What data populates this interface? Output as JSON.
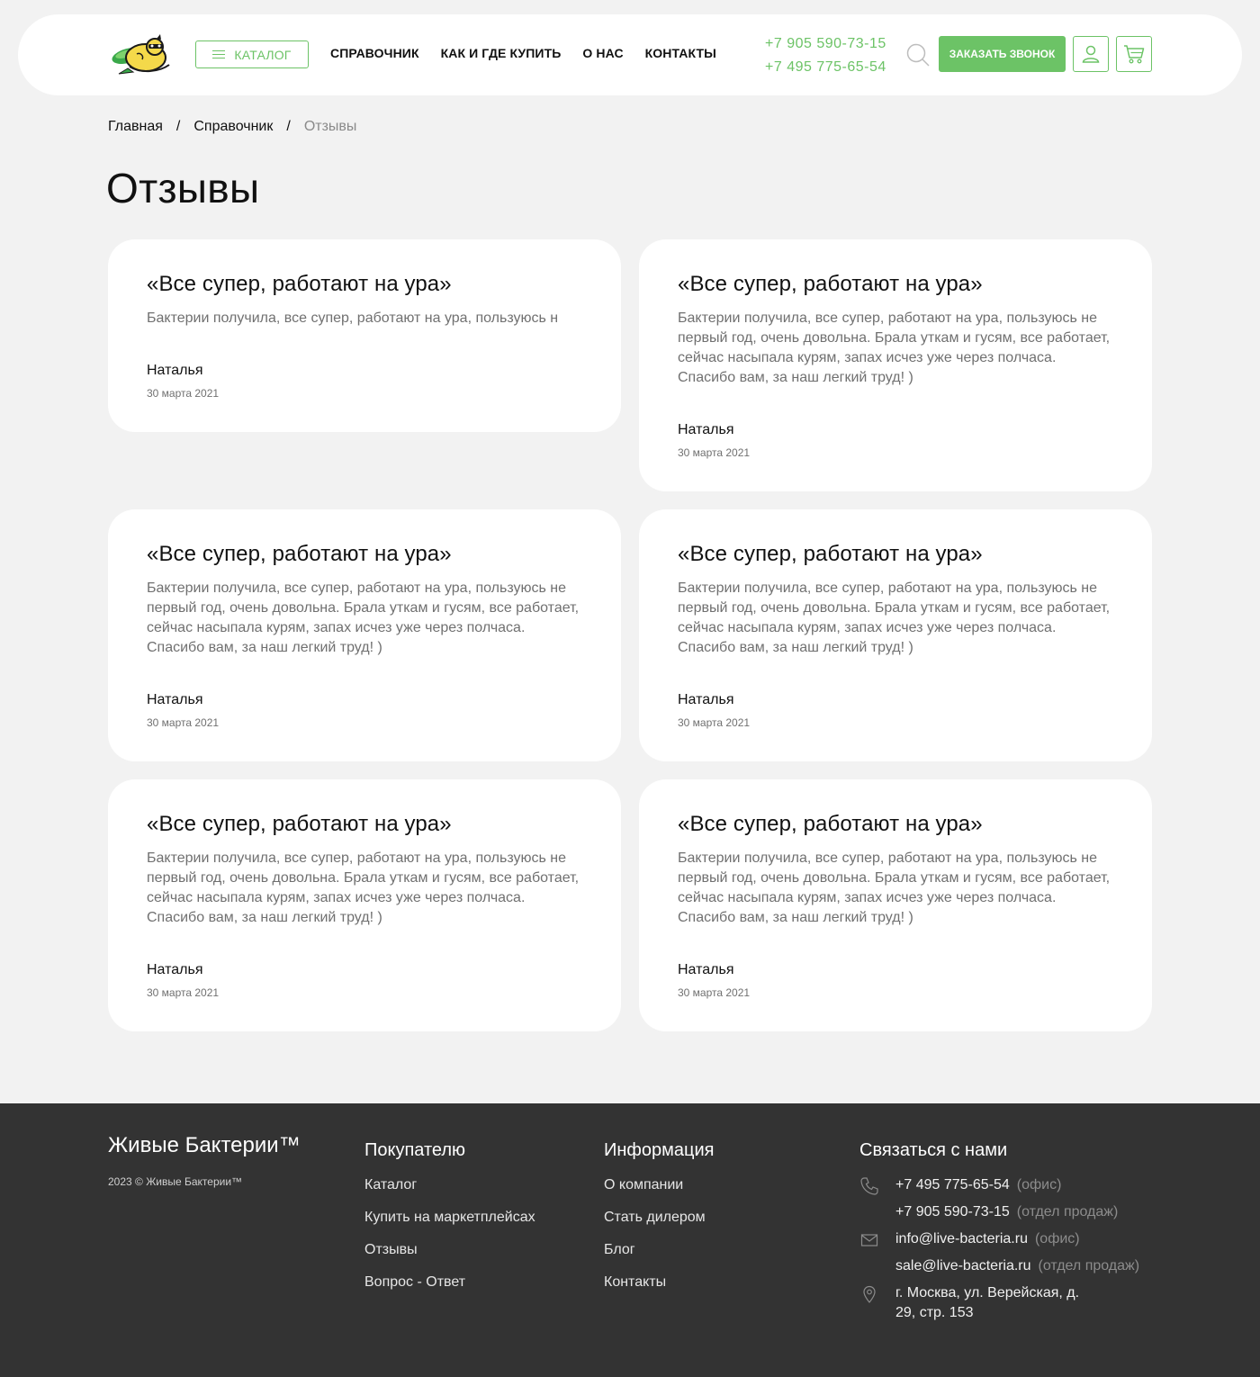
{
  "header": {
    "catalog_label": "КАТАЛОГ",
    "nav": [
      "СПРАВОЧНИК",
      "КАК И ГДЕ КУПИТЬ",
      "О НАС",
      "КОНТАКТЫ"
    ],
    "phones": [
      "+7 905 590-73-15",
      "+7 495 775-65-54"
    ],
    "call_label": "ЗАКАЗАТЬ ЗВОНОК",
    "accent_color": "#6cc366"
  },
  "breadcrumb": {
    "items": [
      "Главная",
      "Справочник"
    ],
    "separator": "/",
    "current": "Отзывы"
  },
  "page": {
    "title": "Отзывы"
  },
  "reviews": [
    {
      "title": "«Все супер, работают на ура»",
      "text": "Бактерии получила, все супер, работают на ура, пользуюсь н",
      "author": "Наталья",
      "date": "30 марта 2021"
    },
    {
      "title": "«Все супер, работают на ура»",
      "text": "Бактерии получила, все супер, работают на ура, пользуюсь не первый год, очень довольна. Брала уткам и гусям, все работает, сейчас насыпала курям, запах исчез уже через полчаса. Спасибо вам, за наш легкий труд! )",
      "author": "Наталья",
      "date": "30 марта 2021"
    },
    {
      "title": "«Все супер, работают на ура»",
      "text": "Бактерии получила, все супер, работают на ура, пользуюсь не первый год, очень довольна. Брала уткам и гусям, все работает, сейчас насыпала курям, запах исчез уже через полчаса. Спасибо вам, за наш легкий труд! )",
      "author": "Наталья",
      "date": "30 марта 2021"
    },
    {
      "title": "«Все супер, работают на ура»",
      "text": "Бактерии получила, все супер, работают на ура, пользуюсь не первый год, очень довольна. Брала уткам и гусям, все работает, сейчас насыпала курям, запах исчез уже через полчаса. Спасибо вам, за наш легкий труд! )",
      "author": "Наталья",
      "date": "30 марта 2021"
    },
    {
      "title": "«Все супер, работают на ура»",
      "text": "Бактерии получила, все супер, работают на ура, пользуюсь не первый год, очень довольна. Брала уткам и гусям, все работает, сейчас насыпала курям, запах исчез уже через полчаса. Спасибо вам, за наш легкий труд! )",
      "author": "Наталья",
      "date": "30 марта 2021"
    },
    {
      "title": "«Все супер, работают на ура»",
      "text": "Бактерии получила, все супер, работают на ура, пользуюсь не первый год, очень довольна. Брала уткам и гусям, все работает, сейчас насыпала курям, запах исчез уже через полчаса. Спасибо вам, за наш легкий труд! )",
      "author": "Наталья",
      "date": "30 марта 2021"
    }
  ],
  "footer": {
    "brand": "Живые Бактерии™",
    "copyright": "2023 © Живые Бактерии™",
    "buyer": {
      "heading": "Покупателю",
      "links": [
        "Каталог",
        "Купить на маркетплейсах",
        "Отзывы",
        "Вопрос - Ответ"
      ]
    },
    "info": {
      "heading": "Информация",
      "links": [
        "О компании",
        "Стать дилером",
        "Блог",
        "Контакты"
      ]
    },
    "contacts": {
      "heading": "Связаться с нами",
      "phones": [
        {
          "value": "+7 495 775-65-54",
          "note": "(офис)"
        },
        {
          "value": "+7 905 590-73-15",
          "note": "(отдел продаж)"
        }
      ],
      "emails": [
        {
          "value": "info@live-bacteria.ru",
          "note": "(офис)"
        },
        {
          "value": "sale@live-bacteria.ru",
          "note": "(отдел продаж)"
        }
      ],
      "address_line1": "г. Москва, ул. Верейская, д.",
      "address_line2": "29, стр. 153"
    }
  }
}
